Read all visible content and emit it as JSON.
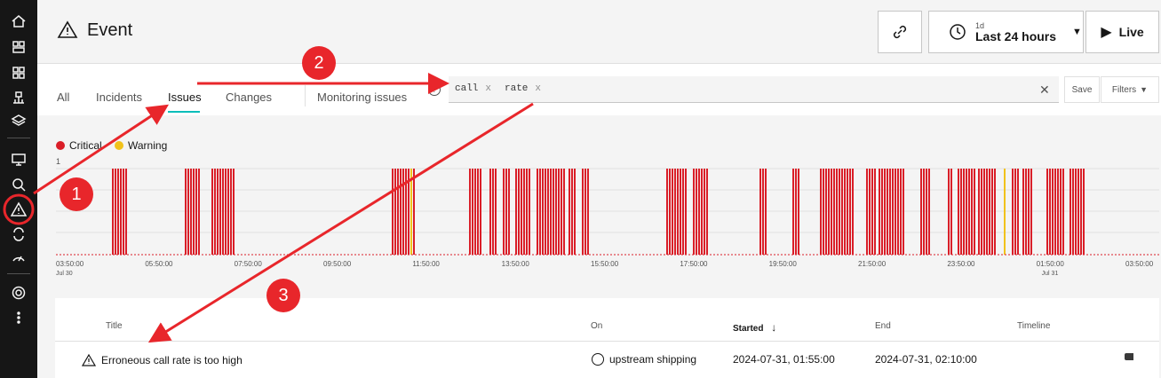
{
  "header": {
    "title": "Event",
    "timerange": {
      "small": "1d",
      "label": "Last 24 hours"
    },
    "live_label": "Live"
  },
  "tabs": [
    {
      "label": "All"
    },
    {
      "label": "Incidents"
    },
    {
      "label": "Issues"
    },
    {
      "label": "Changes"
    },
    {
      "label": "Monitoring issues"
    }
  ],
  "search": {
    "chips": [
      {
        "label": "call"
      },
      {
        "label": "rate"
      }
    ],
    "save_label": "Save",
    "filters_label": "Filters"
  },
  "legend": [
    {
      "label": "Critical",
      "color": "#da1e28"
    },
    {
      "label": "Warning",
      "color": "#f1c21b"
    }
  ],
  "chart_data": {
    "type": "bar",
    "ylim": [
      0,
      1
    ],
    "y_tick": "1",
    "x_ticks": [
      "03:50:00",
      "05:50:00",
      "07:50:00",
      "09:50:00",
      "11:50:00",
      "13:50:00",
      "15:50:00",
      "17:50:00",
      "19:50:00",
      "21:50:00",
      "23:50:00",
      "01:50:00",
      "03:50:00"
    ],
    "x_subticks": {
      "0": "Jul 30",
      "11": "Jul 31"
    },
    "series": [
      {
        "name": "Critical",
        "color": "#da1e28"
      },
      {
        "name": "Warning",
        "color": "#f1c21b"
      }
    ]
  },
  "table": {
    "headers": {
      "title": "Title",
      "on": "On",
      "started": "Started",
      "end": "End",
      "timeline": "Timeline"
    },
    "rows": [
      {
        "title": "Erroneous call rate is too high",
        "on": "upstream shipping",
        "started": "2024-07-31, 01:55:00",
        "end": "2024-07-31, 02:10:00"
      }
    ]
  },
  "annotations": [
    "1",
    "2",
    "3"
  ]
}
